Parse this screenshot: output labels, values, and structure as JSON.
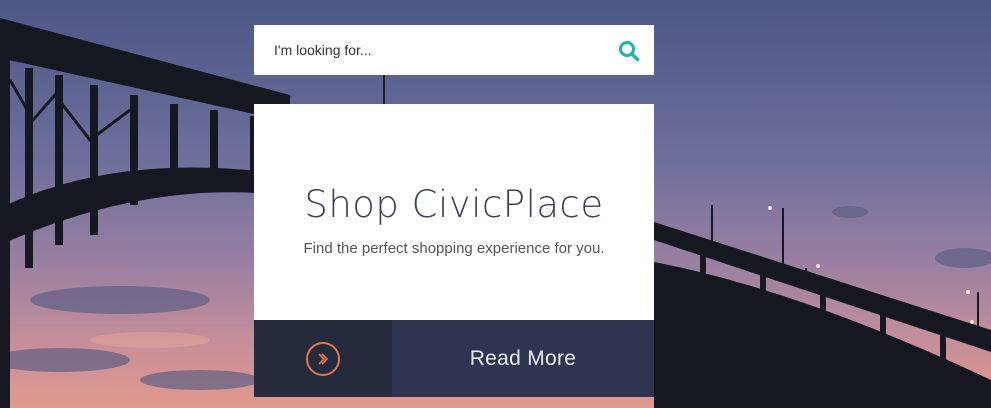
{
  "search": {
    "placeholder": "I'm looking for..."
  },
  "promo": {
    "title": "Shop CivicPlace",
    "subtitle": "Find the perfect shopping experience for you."
  },
  "cta": {
    "label": "Read More",
    "icon": "chevron-right-circle-icon",
    "accent_color": "#e0784a"
  },
  "colors": {
    "search_icon": "#1fb5a0",
    "cta_dark": "#252a3c",
    "cta_light": "#2f3550",
    "title_text": "#3b4256"
  },
  "background": {
    "icon": "bridge-sunset-photo"
  }
}
